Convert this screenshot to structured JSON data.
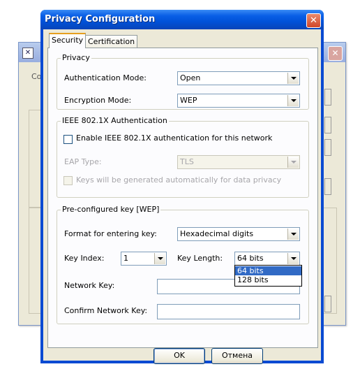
{
  "window": {
    "title": "Privacy Configuration"
  },
  "background_window": {
    "visible_text": "Co"
  },
  "tabs": [
    {
      "label": "Security",
      "active": true
    },
    {
      "label": "Certification",
      "active": false
    }
  ],
  "privacy": {
    "group_label": "Privacy",
    "auth_mode_label": "Authentication Mode:",
    "auth_mode_value": "Open",
    "encryption_mode_label": "Encryption Mode:",
    "encryption_mode_value": "WEP"
  },
  "ieee": {
    "group_label": "IEEE 802.1X Authentication",
    "enable_label": "Enable IEEE 802.1X authentication for this network",
    "enable_checked": false,
    "eap_type_label": "EAP Type:",
    "eap_type_value": "TLS",
    "keys_auto_label": "Keys will be generated automatically for data privacy",
    "keys_auto_checked": false
  },
  "preconfig": {
    "group_label": "Pre-configured key [WEP]",
    "format_label": "Format for entering key:",
    "format_value": "Hexadecimal digits",
    "key_index_label": "Key Index:",
    "key_index_value": "1",
    "key_length_label": "Key Length:",
    "key_length_value": "64 bits",
    "key_length_options": [
      "64 bits",
      "128 bits"
    ],
    "network_key_label": "Network Key:",
    "network_key_value": "",
    "confirm_key_label": "Confirm Network Key:",
    "confirm_key_value": ""
  },
  "buttons": {
    "ok": "OK",
    "cancel": "Отмена"
  }
}
